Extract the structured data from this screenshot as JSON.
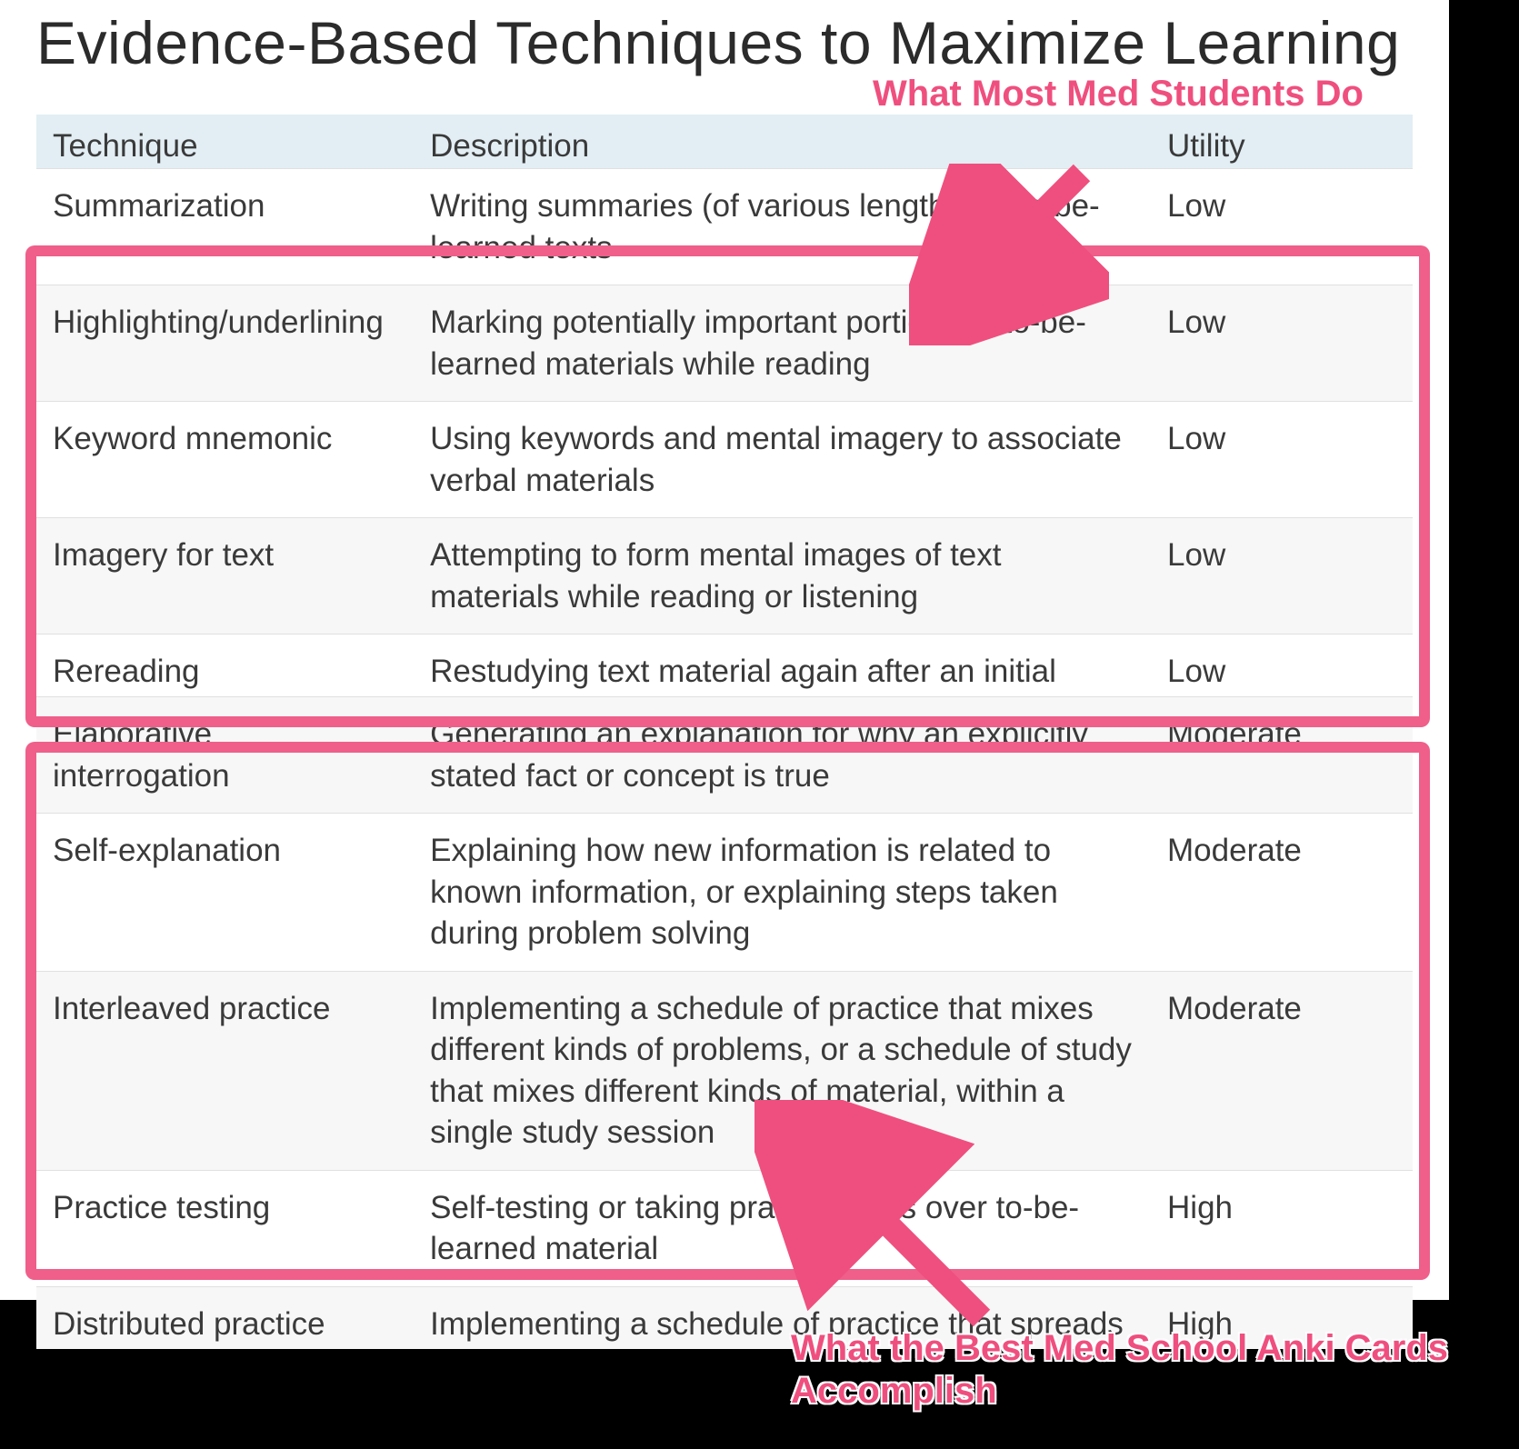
{
  "title": "Evidence-Based Techniques to Maximize Learning",
  "columns": {
    "c0": "Technique",
    "c1": "Description",
    "c2": "Utility"
  },
  "rows": [
    {
      "technique": "Summarization",
      "description": "Writing summaries (of various lengths) of to-be-learned texts",
      "utility": "Low"
    },
    {
      "technique": "Highlighting/underlining",
      "description": "Marking potentially important portions of to-be-learned materials while reading",
      "utility": "Low"
    },
    {
      "technique": "Keyword mnemonic",
      "description": "Using keywords and mental imagery to associate verbal materials",
      "utility": "Low"
    },
    {
      "technique": "Imagery for text",
      "description": "Attempting to form mental images of text materials while reading or listening",
      "utility": "Low"
    },
    {
      "technique": "Rereading",
      "description": "Restudying text material again after an initial reading",
      "utility": "Low"
    },
    {
      "technique": "Elaborative interrogation",
      "description": "Generating an explanation for why an explicitly stated fact or concept is true",
      "utility": "Moderate"
    },
    {
      "technique": "Self-explanation",
      "description": "Explaining how new information is related to known information, or explaining steps taken during problem solving",
      "utility": "Moderate"
    },
    {
      "technique": "Interleaved practice",
      "description": "Implementing a schedule of practice that mixes different kinds of problems, or a schedule of study that mixes different kinds of material, within a single study session",
      "utility": "Moderate"
    },
    {
      "technique": "Practice testing",
      "description": "Self-testing or taking practice tests over to-be-learned material",
      "utility": "High"
    },
    {
      "technique": "Distributed practice",
      "description": "Implementing a schedule of practice that spreads out study activities over time",
      "utility": "High"
    }
  ],
  "annotations": {
    "top_label": "What Most Med Students Do",
    "bottom_label": "What the Best Med School Anki Cards Accomplish"
  }
}
